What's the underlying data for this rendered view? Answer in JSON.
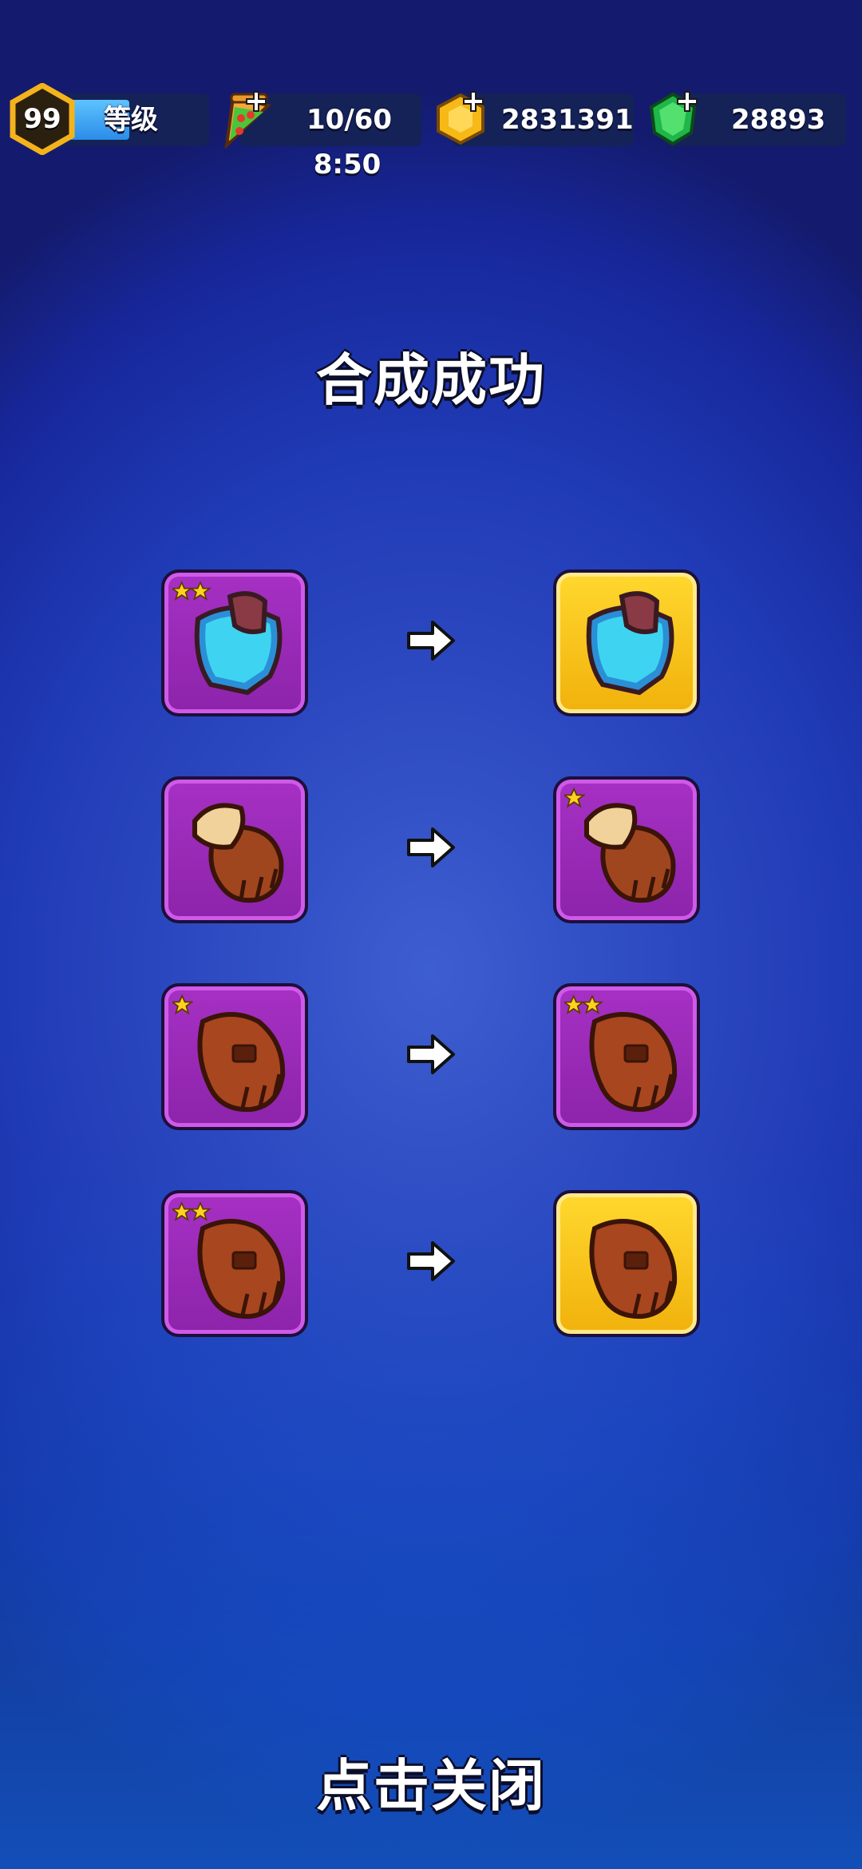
{
  "hud": {
    "level": {
      "number": "99",
      "label": "等级",
      "progress": 0.5
    },
    "energy": {
      "value": "10/60",
      "timer": "8:50"
    },
    "gold": {
      "value": "2831391"
    },
    "gems": {
      "value": "28893"
    }
  },
  "title": "合成成功",
  "close_label": "点击关闭",
  "colors": {
    "purple_card": "#9b2bba",
    "gold_card": "#f8c51c",
    "background": "#2a44bc"
  },
  "merges": [
    {
      "from": {
        "item": "armor-icon",
        "stars": 2,
        "frame": "purple"
      },
      "to": {
        "item": "armor-icon",
        "stars": 0,
        "frame": "gold"
      }
    },
    {
      "from": {
        "item": "fur-glove-icon",
        "stars": 0,
        "frame": "purple"
      },
      "to": {
        "item": "fur-glove-icon",
        "stars": 1,
        "frame": "purple"
      }
    },
    {
      "from": {
        "item": "leather-glove-icon",
        "stars": 1,
        "frame": "purple"
      },
      "to": {
        "item": "leather-glove-icon",
        "stars": 2,
        "frame": "purple"
      }
    },
    {
      "from": {
        "item": "leather-glove-icon",
        "stars": 2,
        "frame": "purple"
      },
      "to": {
        "item": "leather-glove-icon",
        "stars": 0,
        "frame": "gold"
      }
    }
  ]
}
